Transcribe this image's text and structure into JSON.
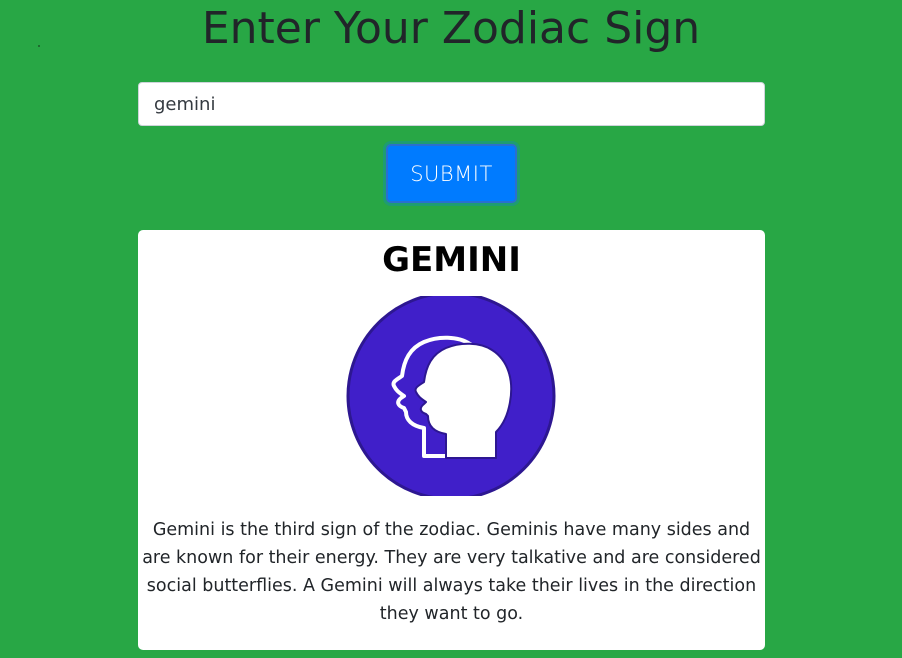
{
  "header": {
    "title": "Enter Your Zodiac Sign"
  },
  "form": {
    "input_value": "gemini",
    "submit_label": "SUBMIT"
  },
  "result": {
    "sign_name": "GEMINI",
    "icon": "gemini-twin-heads-icon",
    "description": "Gemini is the third sign of the zodiac. Geminis have many sides and are known for their energy. They are very talkative and are considered social butterflies. A Gemini will always take their lives in the direction they want to go."
  },
  "colors": {
    "page_background": "#28a745",
    "button": "#007bff",
    "icon_circle": "#401fc9"
  }
}
